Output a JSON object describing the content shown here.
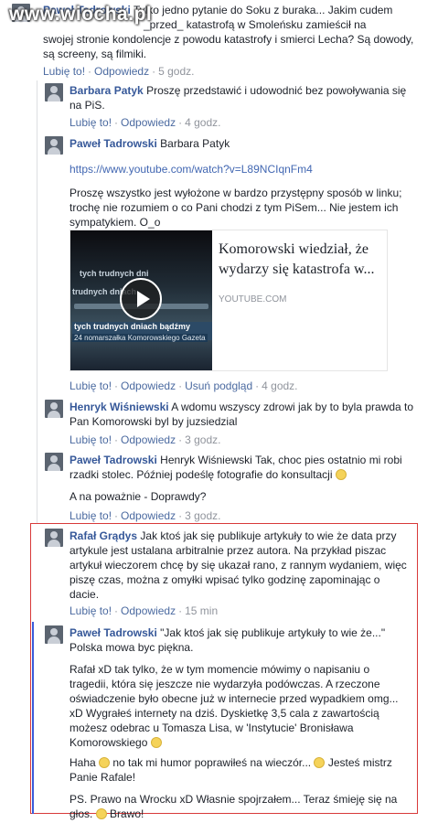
{
  "watermark": "www.wiocha.pl",
  "labels": {
    "like": "Lubię to!",
    "reply": "Odpowiedz",
    "remove_preview": "Usuń podgląd",
    "sep": "·"
  },
  "colors": {
    "name": "#365899",
    "link": "#4267b2",
    "highlight_border": "#d83a3a",
    "thread_marker": "#3b5bdb"
  },
  "comments": [
    {
      "author": "Paweł Tadrowski",
      "lines": [
        "Tylko jedno pytanie do Soku z buraka... Jakim cudem",
        "_przed_ katastrofą w Smoleńsku zamieścił na",
        "swojej stronie kondolencje z powodu katastrofy i smierci Lecha? Są dowody,",
        "są screeny, są filmiki."
      ],
      "time": "5 godz."
    },
    {
      "author": "Barbara Patyk",
      "lines": [
        "Proszę przedstawić i udowodnić bez powoływania się",
        "na PiS."
      ],
      "time": "4 godz."
    },
    {
      "author": "Paweł Tadrowski",
      "first": "Barbara Patyk",
      "url": "https://www.youtube.com/watch?v=L89NCIqnFm4",
      "lines": [
        "Proszę wszystko jest wyłożone w bardzo przystępny sposób w linku;",
        "trochę nie rozumiem o co Pani chodzi z tym PiSem... Nie jestem ich",
        "sympatykiem. O_o"
      ],
      "preview_title": "Komorowski wiedział, że wydarzy się katastrofa w...",
      "preview_source": "YOUTUBE.COM",
      "thumb_text": [
        "tych trudnych dni",
        "trudnych dniach",
        "tych trudnych dniach bądźmy razem",
        "24 nomarszałka Komorowskiego Gazeta"
      ],
      "time": "4 godz."
    },
    {
      "author": "Henryk Wiśniewski",
      "lines": [
        "A wdomu wszyscy zdrowi jak by to byla prawda to",
        "Pan Komorowski byl by juzsiedzial"
      ],
      "time": "3 godz."
    },
    {
      "author": "Paweł Tadrowski",
      "lines": [
        "Henryk Wiśniewski Tak, choc pies ostatnio mi robi",
        "rzadki stolec. Później podeślę fotografie do konsultacji"
      ],
      "line2": "A na poważnie - Doprawdy?",
      "time": "3 godz."
    },
    {
      "author": "Rafał Grądys",
      "lines": [
        "Jak ktoś jak się publikuje artykuły to wie że data przy",
        "artykule jest ustalana arbitralnie przez autora. Na przykład piszac",
        "artykuł wieczorem chcę by się ukazał rano, z rannym wydaniem, więc",
        "piszę czas, można z omyłki wpisać tylko godzinę zapominając o",
        "dacie."
      ],
      "time": "15 min"
    },
    {
      "author": "Paweł Tadrowski",
      "lines": [
        "\"Jak ktoś jak się publikuje artykuły to wie że...\"",
        "Polska mowa byc piękna."
      ],
      "para2": [
        "Rafał xD tak tylko, że w tym momencie mówimy o napisaniu o",
        "tragedii, która się jeszcze nie wydarzyła podówczas. A rzeczone",
        "oświadczenie było obecne już w internecie przed wypadkiem omg...",
        "xD Wygrałeś internety na dziś. Dyskietkę 3,5 cala z zawartością",
        "możesz odebrac u Tomasza Lisa, w 'Instytucie' Bronisława",
        "Komorowskiego"
      ],
      "para3": [
        "Haha",
        "no tak mi humor poprawiłeś na wieczór...",
        "Jesteś mistrz",
        "Panie Rafale!"
      ],
      "para4": [
        "PS. Prawo na Wrocku xD Własnie spojrzałem... Teraz śmieję się na",
        "głos.",
        "Brawo!"
      ]
    }
  ]
}
